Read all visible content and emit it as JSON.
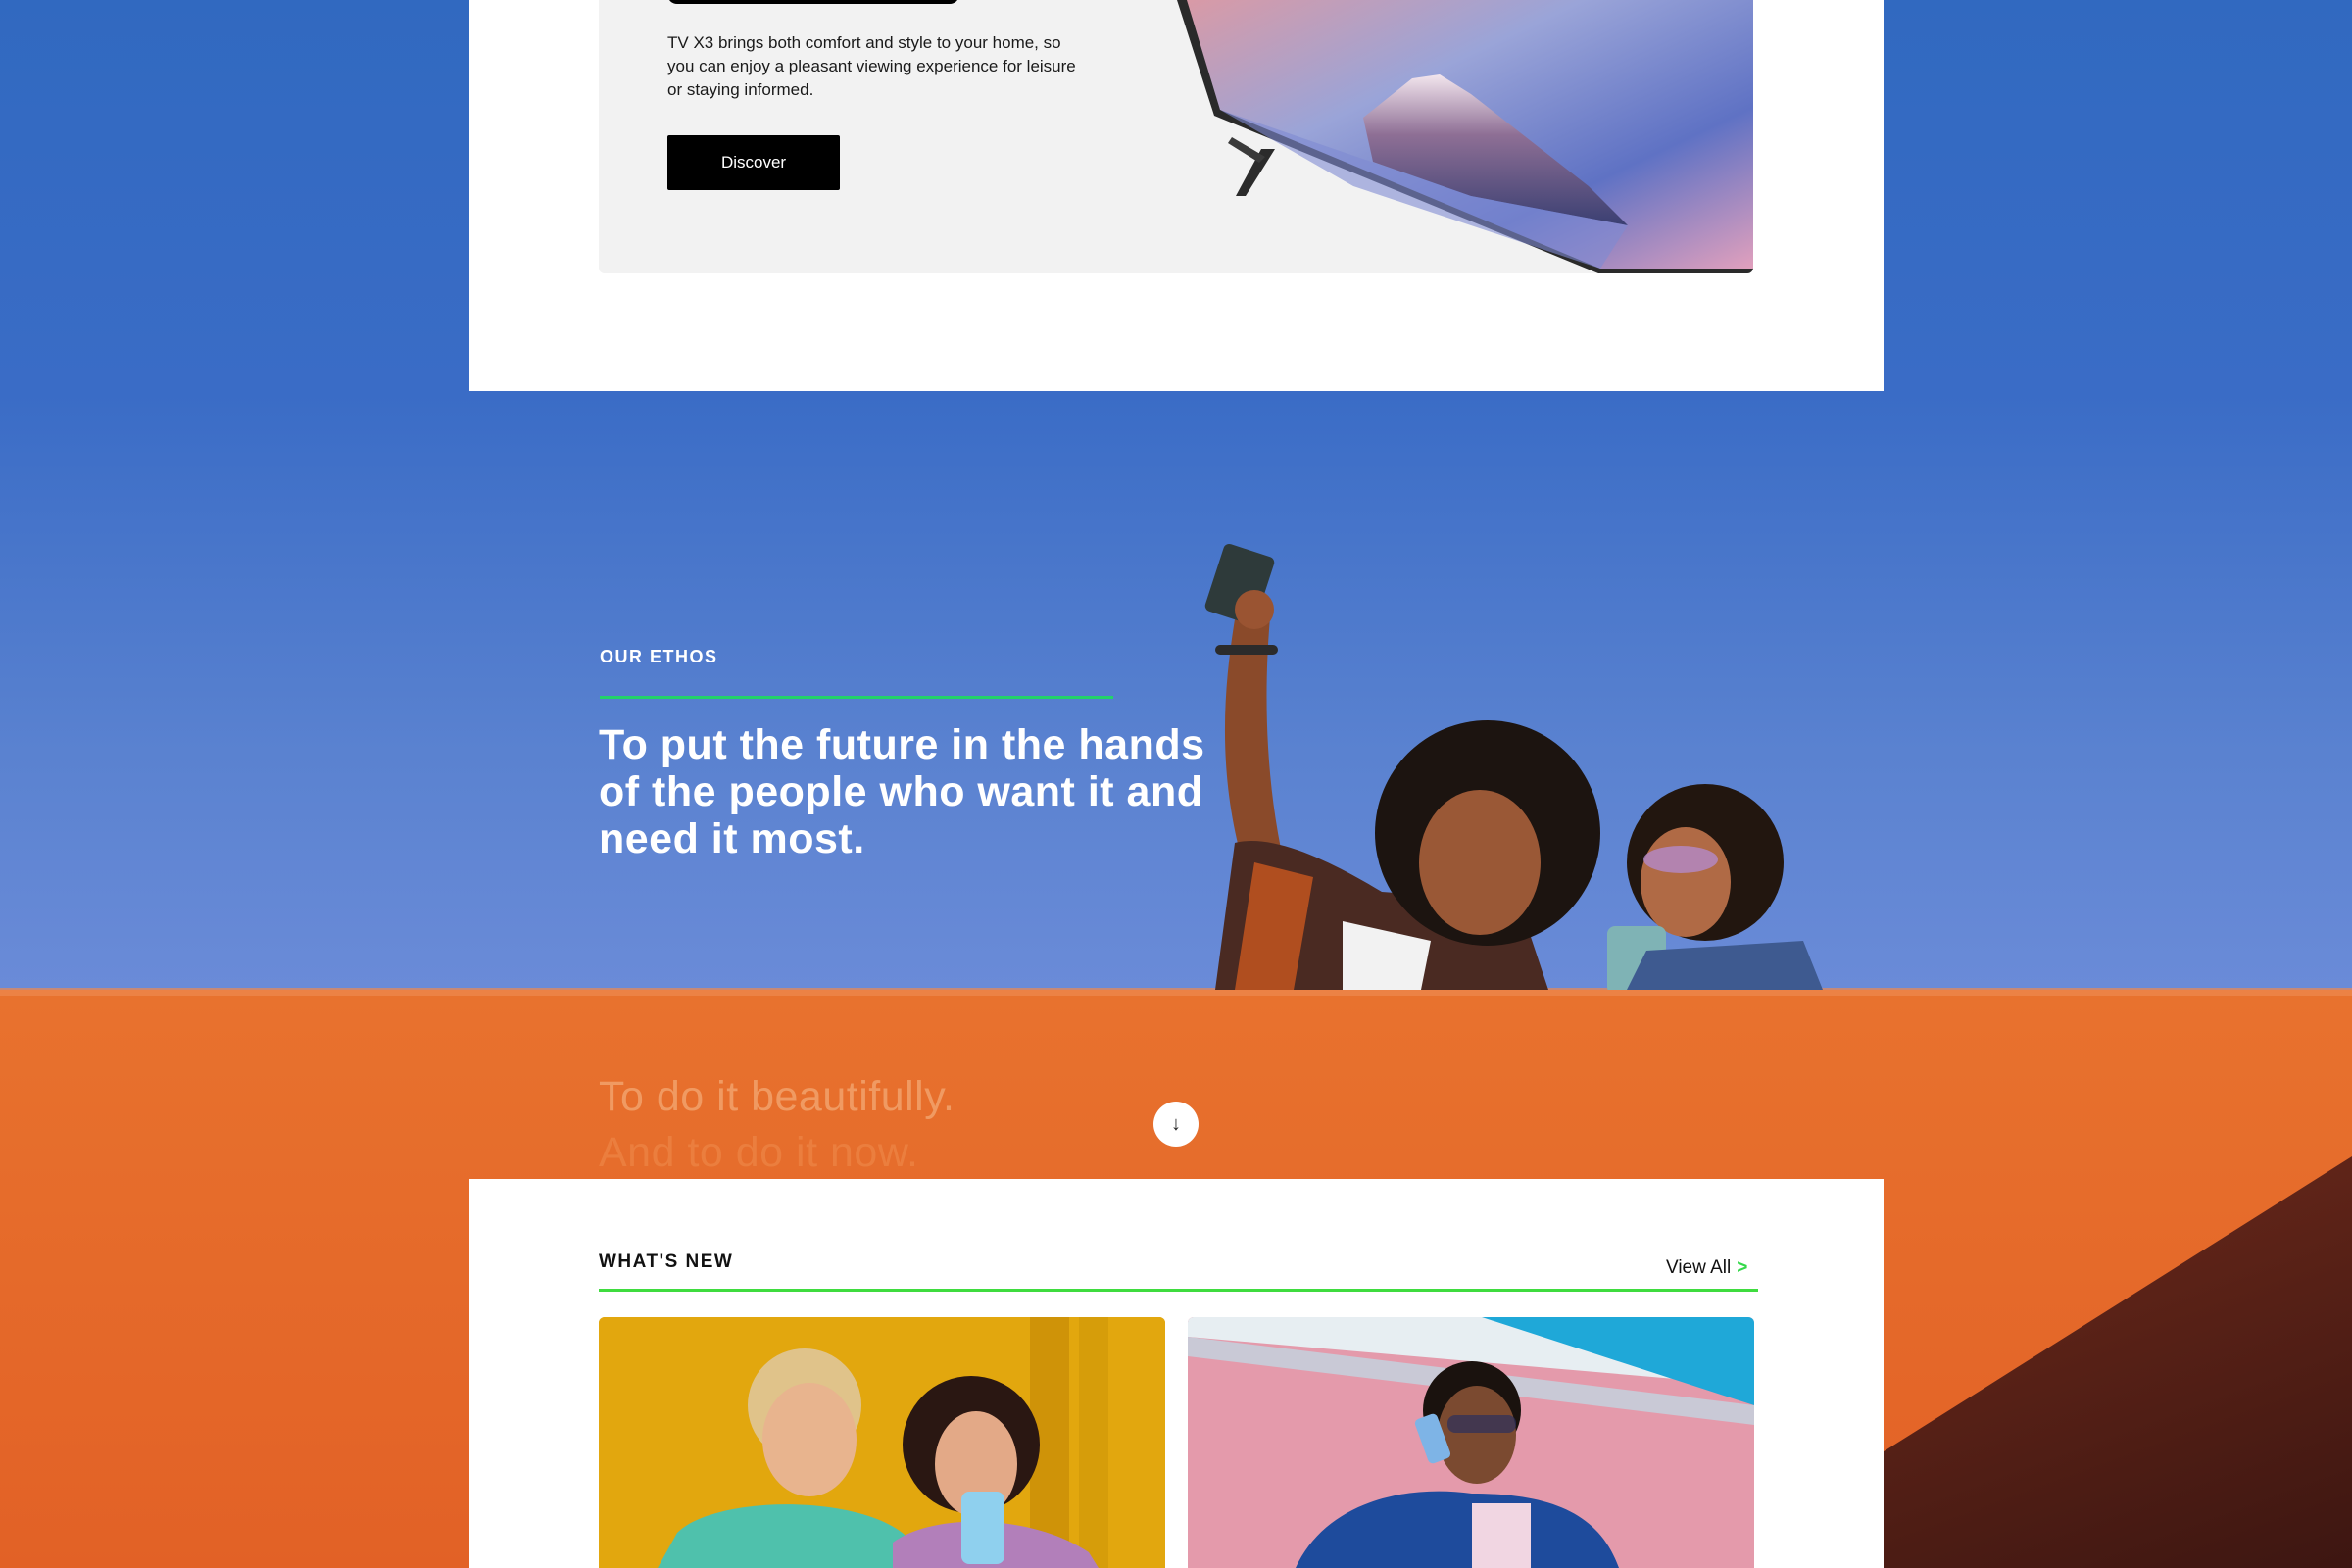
{
  "promo": {
    "description": "TV X3 brings both comfort and style to your home, so you can enjoy a pleasant viewing experience for leisure or staying informed.",
    "button_label": "Discover"
  },
  "ethos": {
    "label": "OUR ETHOS",
    "statement": "To put the future in the hands of the people who want it and need it most.",
    "next_line_1": "To do it beautifully.",
    "next_line_2": "And to do it now."
  },
  "scroll": {
    "icon": "↓"
  },
  "whats_new": {
    "title": "WHAT'S NEW",
    "view_all_label": "View All",
    "view_all_chevron": ">"
  },
  "colors": {
    "accent_green": "#22d36a",
    "sky_blue": "#3a6cc6",
    "orange": "#e6692a"
  }
}
